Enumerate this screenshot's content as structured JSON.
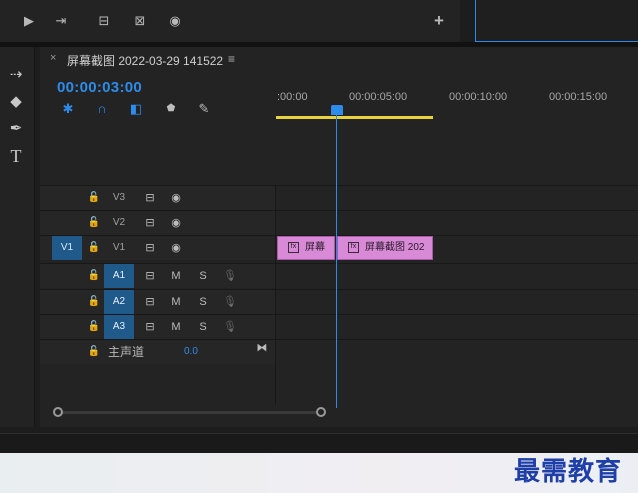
{
  "toolbar": {
    "buttons": [
      {
        "icon": "play-to-in-icon",
        "glyph": "▶"
      },
      {
        "icon": "step-forward-icon",
        "glyph": "⇥"
      },
      {
        "icon": "insert-icon",
        "glyph": "⊟"
      },
      {
        "icon": "overwrite-icon",
        "glyph": "⊠"
      },
      {
        "icon": "camera-icon",
        "glyph": "◉"
      }
    ],
    "add_glyph": "+"
  },
  "tools": [
    {
      "icon": "track-select-icon",
      "glyph": "⇢"
    },
    {
      "icon": "razor-icon",
      "glyph": "◆"
    },
    {
      "icon": "pen-icon",
      "glyph": "✒"
    },
    {
      "icon": "type-icon",
      "glyph": "T"
    }
  ],
  "sequence": {
    "tab_close": "×",
    "tab_title": "屏幕截图 2022-03-29 141522",
    "tab_menu": "≡",
    "timecode": "00:00:03:00"
  },
  "timeline_icons": [
    {
      "icon": "nest-icon",
      "glyph": "✱",
      "color": "#2d8ceb"
    },
    {
      "icon": "snap-icon",
      "glyph": "∩",
      "color": "#2d8ceb"
    },
    {
      "icon": "linked-selection-icon",
      "glyph": "◧",
      "color": "#2d8ceb"
    },
    {
      "icon": "marker-icon",
      "glyph": "⬟",
      "color": "#bcbcbc"
    },
    {
      "icon": "wrench-icon",
      "glyph": "✎",
      "color": "#bcbcbc"
    }
  ],
  "ruler": {
    "labels": [
      ":00:00",
      "00:00:05:00",
      "00:00:10:00",
      "00:00:15:00"
    ]
  },
  "tracks": {
    "video": [
      {
        "name": "V3",
        "source": ""
      },
      {
        "name": "V2",
        "source": ""
      },
      {
        "name": "V1",
        "source": "V1"
      }
    ],
    "audio": [
      {
        "name": "A1",
        "source": "",
        "mute": "M",
        "solo": "S"
      },
      {
        "name": "A2",
        "source": "",
        "mute": "M",
        "solo": "S"
      },
      {
        "name": "A3",
        "source": "",
        "mute": "M",
        "solo": "S"
      }
    ],
    "master": {
      "label": "主声道",
      "volume": "0.0"
    }
  },
  "clips": [
    {
      "fx": "fx",
      "label": "屏幕"
    },
    {
      "fx": "fx",
      "label": "屏幕截图 202"
    }
  ],
  "watermark": "最需教育",
  "colors": {
    "accent": "#2d8ceb",
    "work_area": "#e7d33d",
    "clip": "#d98ad7",
    "track_target": "#1f5a8a"
  }
}
